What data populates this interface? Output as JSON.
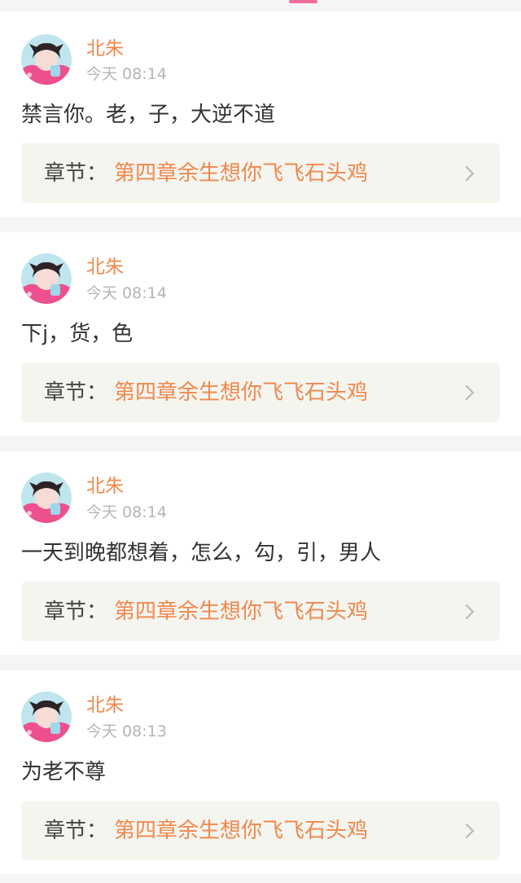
{
  "colors": {
    "accent_pink": "#f06a9b",
    "username_orange": "#f0884c",
    "chapter_bg": "#f5f5f0"
  },
  "icons": {
    "avatar": "anime-avatar-icon",
    "chevron": "chevron-right-icon"
  },
  "comments": [
    {
      "username": "北朱",
      "time": "今天 08:14",
      "content": "禁言你。老，子，大逆不道",
      "chapter_prefix": "章节：",
      "chapter_title": "第四章余生想你飞飞石头鸡"
    },
    {
      "username": "北朱",
      "time": "今天 08:14",
      "content": "下j，货，色",
      "chapter_prefix": "章节：",
      "chapter_title": "第四章余生想你飞飞石头鸡"
    },
    {
      "username": "北朱",
      "time": "今天 08:14",
      "content": "一天到晚都想着，怎么，勾，引，男人",
      "chapter_prefix": "章节：",
      "chapter_title": "第四章余生想你飞飞石头鸡"
    },
    {
      "username": "北朱",
      "time": "今天 08:13",
      "content": "为老不尊",
      "chapter_prefix": "章节：",
      "chapter_title": "第四章余生想你飞飞石头鸡"
    }
  ]
}
